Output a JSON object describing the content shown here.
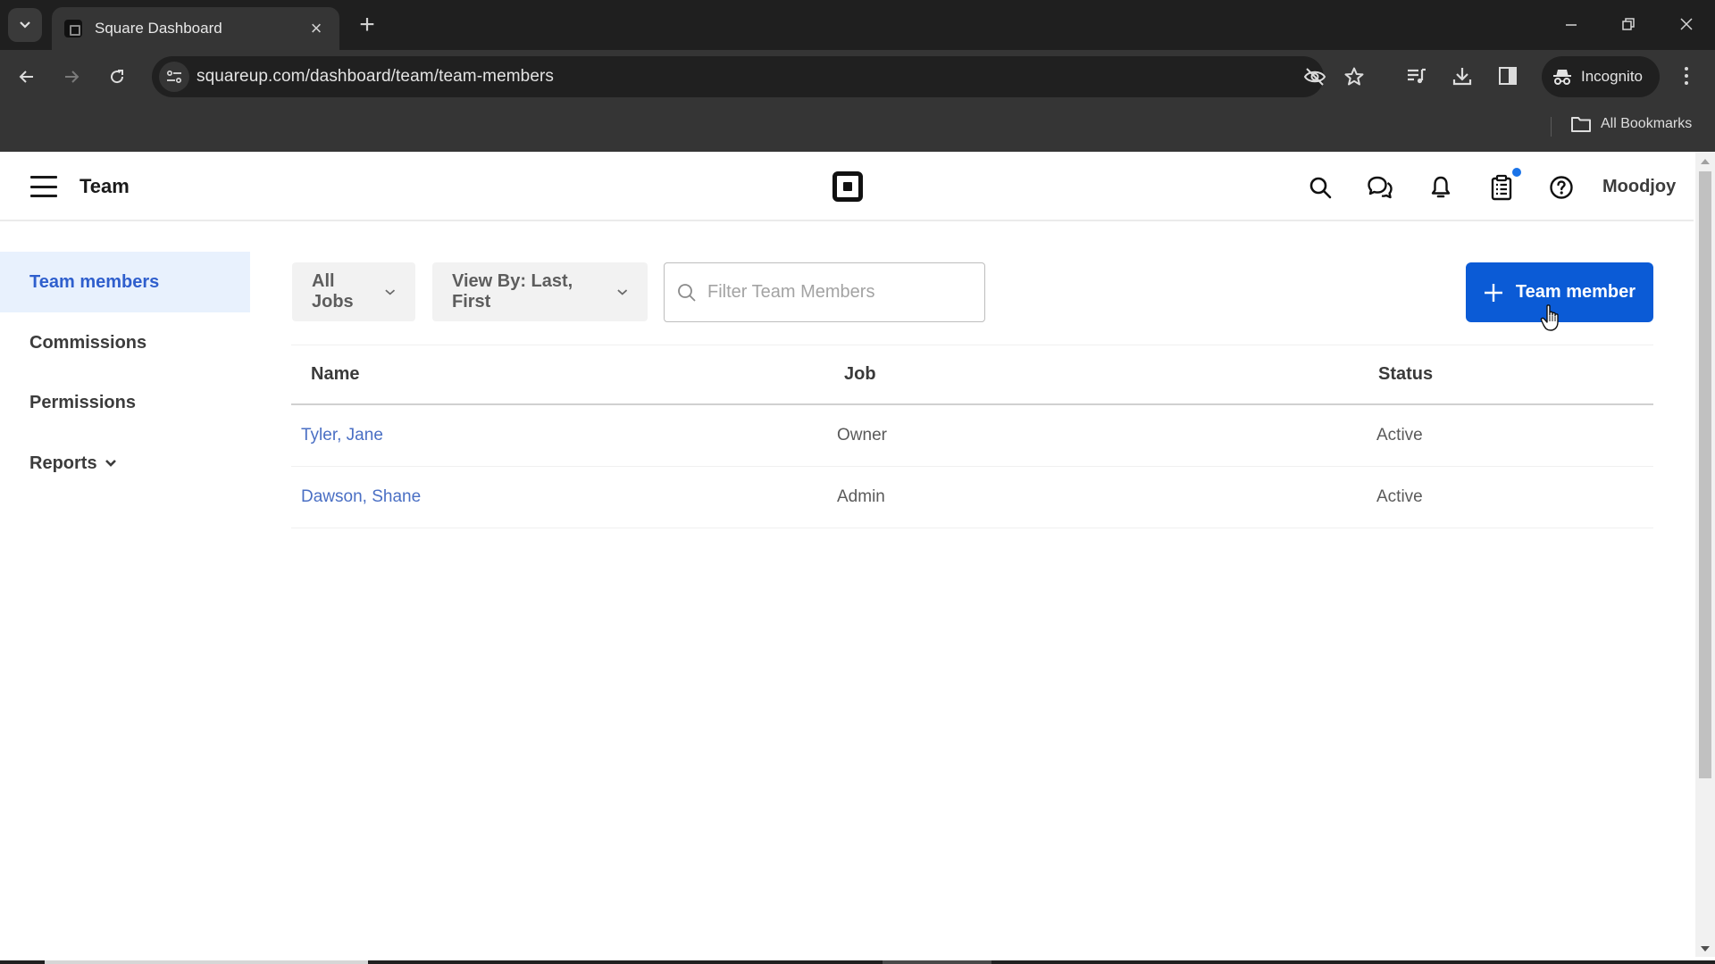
{
  "browser": {
    "tab": {
      "title": "Square Dashboard",
      "close_label": "×"
    },
    "new_tab_label": "+",
    "window_controls": {
      "minimize": "–",
      "restore": "❐",
      "close": "✕"
    },
    "url": "squareup.com/dashboard/team/team-members",
    "profile_label": "Incognito",
    "bookmarks": {
      "all_bookmarks_label": "All Bookmarks"
    }
  },
  "app": {
    "header": {
      "title": "Team",
      "account_name": "Moodjoy",
      "icons": [
        "search-icon",
        "messages-icon",
        "notifications-icon",
        "checklist-icon",
        "help-icon"
      ],
      "checklist_has_notification": true
    },
    "sidebar": {
      "items": [
        {
          "label": "Team members",
          "active": true
        },
        {
          "label": "Commissions",
          "active": false
        },
        {
          "label": "Permissions",
          "active": false
        },
        {
          "label": "Reports",
          "active": false,
          "expandable": true
        }
      ]
    },
    "filters": {
      "jobs_label": "All Jobs",
      "view_by_label": "View By: Last, First",
      "search_placeholder": "Filter Team Members",
      "search_value": ""
    },
    "add_button_label": "Team member",
    "table": {
      "columns": [
        "Name",
        "Job",
        "Status"
      ],
      "rows": [
        {
          "name": "Tyler, Jane",
          "job": "Owner",
          "status": "Active"
        },
        {
          "name": "Dawson, Shane",
          "job": "Admin",
          "status": "Active"
        }
      ]
    },
    "colors": {
      "primary": "#0b5bd6",
      "active_nav_bg": "#e8f1fd",
      "active_nav_text": "#2f5fcd",
      "link": "#4a6fc4",
      "notification_dot": "#1a73e8"
    }
  }
}
